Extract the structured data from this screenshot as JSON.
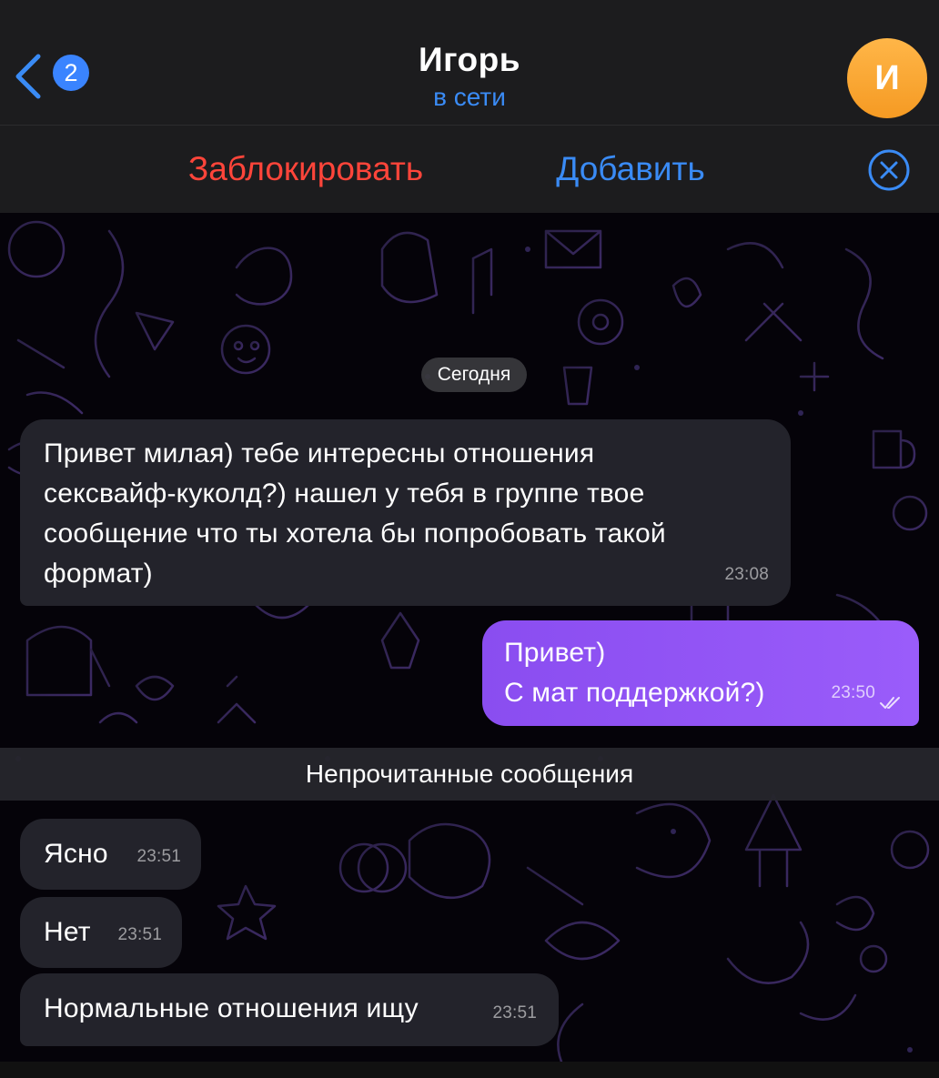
{
  "header": {
    "back_badge": "2",
    "title": "Игорь",
    "status": "в сети",
    "avatar_letter": "И"
  },
  "action_bar": {
    "block_label": "Заблокировать",
    "add_label": "Добавить"
  },
  "chat": {
    "date_chip": "Сегодня",
    "messages": [
      {
        "direction": "incoming",
        "lines": [
          "Привет милая) тебе интересны отношения",
          "сексвайф-куколд?) нашел у тебя в группе твое",
          "сообщение что ты хотела бы попробовать такой",
          "формат)"
        ],
        "time": "23:08"
      },
      {
        "direction": "outgoing",
        "lines": [
          "Привет)",
          "С мат поддержкой?)"
        ],
        "time": "23:50",
        "read": true
      },
      {
        "direction": "incoming",
        "lines": [
          "Ясно"
        ],
        "time": "23:51"
      },
      {
        "direction": "incoming",
        "lines": [
          "Нет"
        ],
        "time": "23:51"
      },
      {
        "direction": "incoming",
        "lines": [
          "Нормальные отношения ищу"
        ],
        "time": "23:51"
      }
    ],
    "unread_label": "Непрочитанные сообщения"
  },
  "colors": {
    "accent_blue": "#3a8bf5",
    "block_red": "#ff453a",
    "outgoing_bubble": "#9a5cfa",
    "incoming_bubble": "#23232b",
    "avatar_orange": "#f5a030"
  },
  "icons": [
    "chevron-left-icon",
    "close-circle-icon",
    "double-check-icon"
  ]
}
